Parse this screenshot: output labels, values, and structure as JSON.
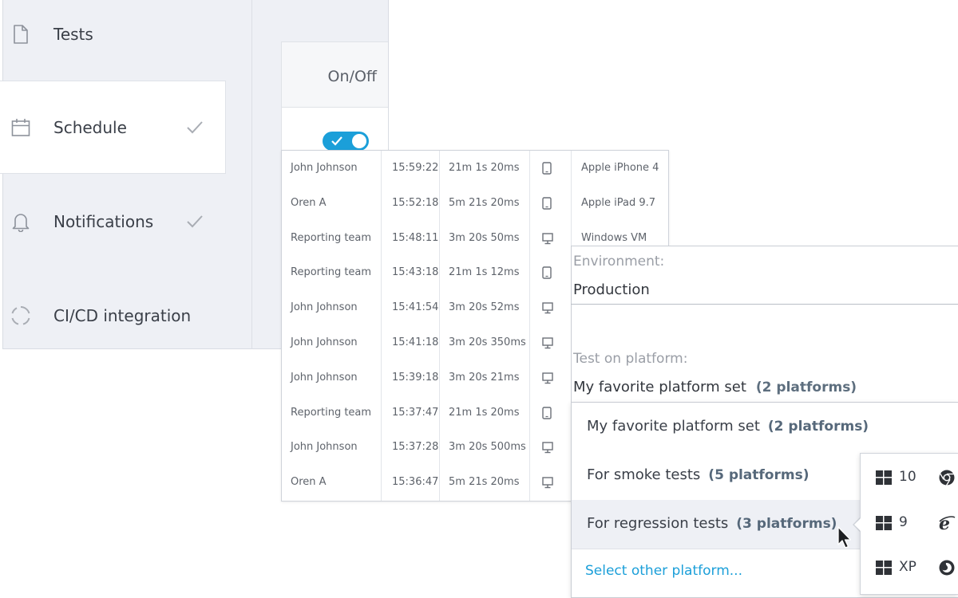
{
  "sidebar": {
    "items": [
      {
        "label": "Tests",
        "icon": "document-icon",
        "checked": false
      },
      {
        "label": "Schedule",
        "icon": "calendar-icon",
        "checked": true,
        "active": true
      },
      {
        "label": "Notifications",
        "icon": "bell-icon",
        "checked": true
      },
      {
        "label": "CI/CD integration",
        "icon": "cicd-spinner-icon",
        "checked": false
      }
    ]
  },
  "schedule": {
    "onoff_header": "On/Off",
    "toggle_on": true
  },
  "runs": [
    {
      "user": "John Johnson",
      "time": "15:59:22",
      "duration": "21m 1s 20ms",
      "device": "mobile-icon",
      "platform": "Apple iPhone 4"
    },
    {
      "user": "Oren A",
      "time": "15:52:18",
      "duration": "5m 21s 20ms",
      "device": "mobile-icon",
      "platform": "Apple iPad 9.7"
    },
    {
      "user": "Reporting team",
      "time": "15:48:11",
      "duration": "3m 20s 50ms",
      "device": "desktop-icon",
      "platform": "Windows VM"
    },
    {
      "user": "Reporting team",
      "time": "15:43:18",
      "duration": "21m 1s 12ms",
      "device": "mobile-icon",
      "platform": ""
    },
    {
      "user": "John Johnson",
      "time": "15:41:54",
      "duration": "3m 20s 52ms",
      "device": "desktop-icon",
      "platform": ""
    },
    {
      "user": "John Johnson",
      "time": "15:41:18",
      "duration": "3m 20s 350ms",
      "device": "desktop-icon",
      "platform": ""
    },
    {
      "user": "John Johnson",
      "time": "15:39:18",
      "duration": "3m 20s 21ms",
      "device": "desktop-icon",
      "platform": ""
    },
    {
      "user": "Reporting team",
      "time": "15:37:47",
      "duration": "21m 1s 20ms",
      "device": "mobile-icon",
      "platform": ""
    },
    {
      "user": "John Johnson",
      "time": "15:37:28",
      "duration": "3m 20s 500ms",
      "device": "desktop-icon",
      "platform": ""
    },
    {
      "user": "Oren A",
      "time": "15:36:47",
      "duration": "5m 21s 20ms",
      "device": "desktop-icon",
      "platform": ""
    }
  ],
  "environment": {
    "label": "Environment:",
    "value": "Production"
  },
  "platform": {
    "label": "Test on platform:",
    "selected_name": "My favorite platform set",
    "selected_count": "(2 platforms)"
  },
  "dropdown": {
    "options": [
      {
        "name": "My favorite platform set",
        "count": "(2 platforms)"
      },
      {
        "name": "For smoke tests",
        "count": "(5 platforms)"
      },
      {
        "name": "For regression tests",
        "count": "(3 platforms)",
        "hover": true
      }
    ],
    "other_link": "Select other platform..."
  },
  "flyout": {
    "rows": [
      {
        "os_icon": "windows-icon",
        "version": "10",
        "browser_icon": "chrome-icon"
      },
      {
        "os_icon": "windows-icon",
        "version": "9",
        "browser_icon": "ie-icon"
      },
      {
        "os_icon": "windows-icon",
        "version": "XP",
        "browser_icon": "firefox-icon"
      }
    ]
  },
  "colors": {
    "accent": "#1b9fd9",
    "sidebar_bg": "#eef0f5",
    "count_text": "#56687a"
  }
}
